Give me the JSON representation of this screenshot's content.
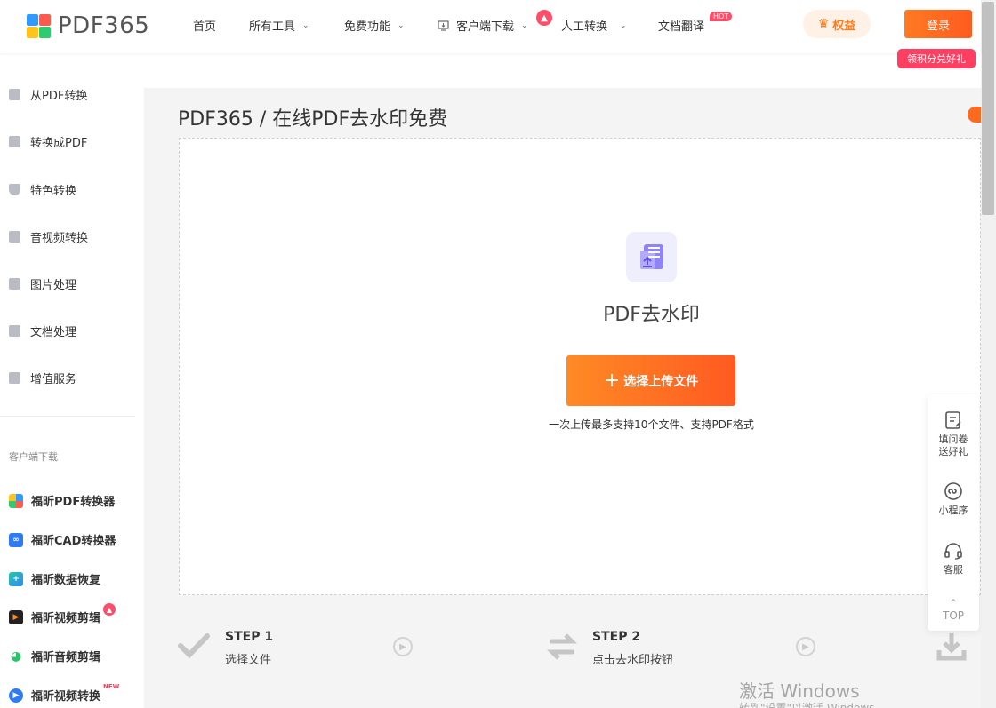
{
  "header": {
    "logo_text": "PDF365",
    "nav": [
      {
        "label": "首页"
      },
      {
        "label": "所有工具"
      },
      {
        "label": "免费功能"
      },
      {
        "label": "客户端下载"
      },
      {
        "label": "人工转换"
      },
      {
        "label": "文档翻译",
        "badge": "HOT"
      }
    ],
    "rights_label": "权益",
    "login_label": "登录",
    "login_tip": "领积分兑好礼"
  },
  "sidebar": {
    "items": [
      {
        "label": "从PDF转换"
      },
      {
        "label": "转换成PDF"
      },
      {
        "label": "特色转换"
      },
      {
        "label": "音视频转换"
      },
      {
        "label": "图片处理"
      },
      {
        "label": "文档处理"
      },
      {
        "label": "增值服务"
      }
    ],
    "group_label": "客户端下载",
    "apps": [
      {
        "label": "福昕PDF转换器"
      },
      {
        "label": "福昕CAD转换器"
      },
      {
        "label": "福昕数据恢复"
      },
      {
        "label": "福昕视频剪辑"
      },
      {
        "label": "福昕音频剪辑"
      },
      {
        "label": "福昕视频转换",
        "badge": "NEW"
      }
    ]
  },
  "main": {
    "page_title": "PDF365 / 在线PDF去水印免费",
    "tool_name": "PDF去水印",
    "upload_label": "选择上传文件",
    "upload_hint": "一次上传最多支持10个文件、支持PDF格式"
  },
  "steps": [
    {
      "title": "STEP 1",
      "desc": "选择文件"
    },
    {
      "title": "STEP 2",
      "desc": "点击去水印按钮"
    }
  ],
  "float_panel": {
    "survey_line1": "填问卷",
    "survey_line2": "送好礼",
    "miniprogram": "小程序",
    "service": "客服",
    "top": "TOP"
  },
  "os_watermark": {
    "line1": "激活 Windows",
    "line2": "转到\"设置\"以激活 Windows。"
  },
  "colors": {
    "accent": "#ff6a1f",
    "hot": "#ff4d6a",
    "tool_icon": "#7b6cf0"
  }
}
